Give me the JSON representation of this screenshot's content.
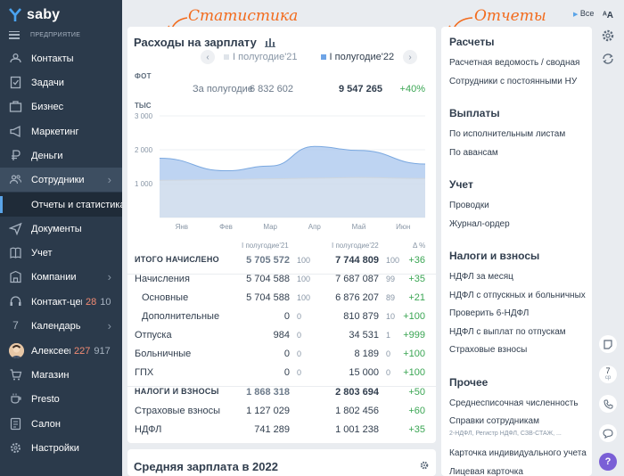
{
  "app": {
    "brand": "saby",
    "company": "ПРЕДПРИЯТИЕ"
  },
  "nav": [
    {
      "label": "Контакты",
      "icon": "contacts-icon"
    },
    {
      "label": "Задачи",
      "icon": "tasks-icon"
    },
    {
      "label": "Бизнес",
      "icon": "briefcase-icon"
    },
    {
      "label": "Маркетинг",
      "icon": "megaphone-icon"
    },
    {
      "label": "Деньги",
      "icon": "ruble-icon"
    },
    {
      "label": "Сотрудники",
      "icon": "employees-icon"
    },
    {
      "label": "Отчеты и статистика",
      "icon": ""
    },
    {
      "label": "Документы",
      "icon": "send-icon"
    },
    {
      "label": "Учет",
      "icon": "ledger-icon"
    },
    {
      "label": "Компании",
      "icon": "companies-icon"
    },
    {
      "label": "Контакт-центр",
      "icon": "contact-center-icon",
      "count_red": "28",
      "count_grey": "10"
    },
    {
      "label": "Календарь",
      "icon": "calendar-icon",
      "cal": "7"
    },
    {
      "label": "Алексеев",
      "icon": "avatar",
      "count_red": "227",
      "count_grey": "917"
    },
    {
      "label": "Магазин",
      "icon": "shop-icon"
    },
    {
      "label": "Presto",
      "icon": "presto-icon"
    },
    {
      "label": "Салон",
      "icon": "salon-icon"
    },
    {
      "label": "Настройки",
      "icon": "settings-icon"
    }
  ],
  "annotations": {
    "stats": "Статистика",
    "reports": "Отчеты"
  },
  "top_right": {
    "all": "Все"
  },
  "stats": {
    "title": "Расходы на зарплату",
    "period_prev": "I полугодие'21",
    "period_cur": "I полугодие'22",
    "fot": "ФОТ",
    "for_half": "За полугодие",
    "prev_total": "6 832 602",
    "cur_total": "9 547 265",
    "delta_total": "+40%",
    "unit": "ТЫС"
  },
  "chart_data": {
    "type": "area",
    "x": [
      "Янв",
      "Фев",
      "Мар",
      "Апр",
      "Май",
      "Июн"
    ],
    "yticks": [
      "3 000",
      "2 000",
      "1 000",
      "0"
    ],
    "ylim": [
      0,
      3000
    ],
    "series": [
      {
        "name": "I полугодие'22",
        "values": [
          1750,
          1380,
          1520,
          2100,
          1980,
          1580
        ],
        "color": "#a8c6ee"
      },
      {
        "name": "I полугодие'21",
        "values": [
          1100,
          1120,
          1140,
          1160,
          1180,
          1150
        ],
        "color": "#e2e7ed"
      }
    ]
  },
  "table": {
    "head": {
      "prev": "I полугодие'21",
      "cur": "I полугодие'22",
      "delta": "Δ %"
    },
    "rows": [
      {
        "label": "ИТОГО НАЧИСЛЕНО",
        "v1": "5 705 572",
        "p1": "100",
        "v2": "7 744 809",
        "p2": "100",
        "d": "+36",
        "style": "bold"
      },
      {
        "label": "Начисления",
        "v1": "5 704 588",
        "p1": "100",
        "v2": "7 687 087",
        "p2": "99",
        "d": "+35",
        "style": ""
      },
      {
        "label": "Основные",
        "v1": "5 704 588",
        "p1": "100",
        "v2": "6 876 207",
        "p2": "89",
        "d": "+21",
        "style": "indent"
      },
      {
        "label": "Дополнительные",
        "v1": "0",
        "p1": "0",
        "v2": "810 879",
        "p2": "10",
        "d": "+100",
        "style": "indent"
      },
      {
        "label": "Отпуска",
        "v1": "984",
        "p1": "0",
        "v2": "34 531",
        "p2": "1",
        "d": "+999",
        "style": ""
      },
      {
        "label": "Больничные",
        "v1": "0",
        "p1": "0",
        "v2": "8 189",
        "p2": "0",
        "d": "+100",
        "style": ""
      },
      {
        "label": "ГПХ",
        "v1": "0",
        "p1": "0",
        "v2": "15 000",
        "p2": "0",
        "d": "+100",
        "style": ""
      },
      {
        "label": "НАЛОГИ И ВЗНОСЫ",
        "v1": "1 868 318",
        "p1": "",
        "v2": "2 803 694",
        "p2": "",
        "d": "+50",
        "style": "bold"
      },
      {
        "label": "Страховые взносы",
        "v1": "1 127 029",
        "p1": "",
        "v2": "1 802 456",
        "p2": "",
        "d": "+60",
        "style": ""
      },
      {
        "label": "НДФЛ",
        "v1": "741 289",
        "p1": "",
        "v2": "1 001 238",
        "p2": "",
        "d": "+35",
        "style": ""
      }
    ]
  },
  "bottom": {
    "title": "Средняя зарплата в  2022"
  },
  "reports": {
    "sections": [
      {
        "title": "Расчеты",
        "items": [
          "Расчетная ведомость / сводная",
          "Сотрудники с постоянными НУ"
        ]
      },
      {
        "title": "Выплаты",
        "items": [
          "По исполнительным листам",
          "По авансам"
        ]
      },
      {
        "title": "Учет",
        "items": [
          "Проводки",
          "Журнал-ордер"
        ]
      },
      {
        "title": "Налоги и взносы",
        "items": [
          "НДФЛ за месяц",
          "НДФЛ с отпускных и больничных",
          "Проверить 6-НДФЛ",
          "НДФЛ с выплат по отпускам",
          "Страховые взносы"
        ]
      },
      {
        "title": "Прочее",
        "items": [
          "Среднесписочная численность",
          "Справки сотрудникам",
          "Карточка индивидуального учета",
          "Лицевая карточка"
        ]
      }
    ],
    "subnote": "2-НДФЛ, Регистр НДФЛ, СЗВ-СТАЖ, ..."
  },
  "strip": {
    "cal_num": "7",
    "cal_day": "ср",
    "help": "?"
  }
}
